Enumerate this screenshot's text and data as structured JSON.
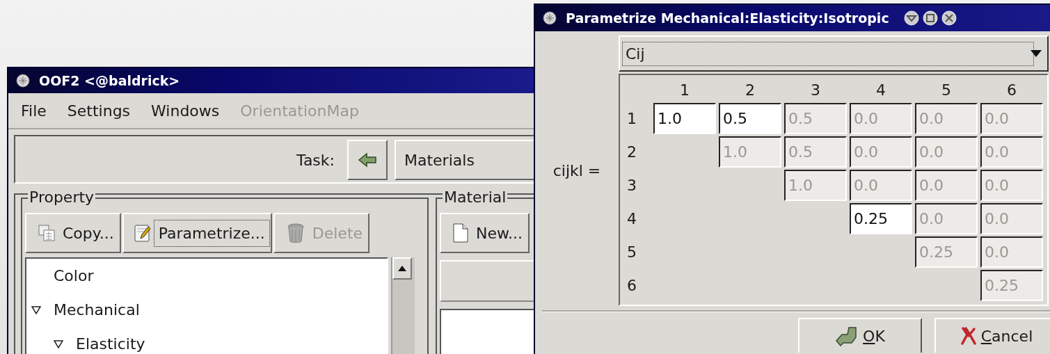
{
  "main_window": {
    "title": "OOF2 <@baldrick>",
    "menu": [
      {
        "label": "File",
        "disabled": false
      },
      {
        "label": "Settings",
        "disabled": false
      },
      {
        "label": "Windows",
        "disabled": false
      },
      {
        "label": "OrientationMap",
        "disabled": true
      }
    ],
    "task_label": "Task:",
    "task_value": "Materials",
    "property": {
      "title": "Property",
      "buttons": [
        {
          "label": "Copy...",
          "disabled": false,
          "focused": false
        },
        {
          "label": "Parametrize...",
          "disabled": false,
          "focused": true
        },
        {
          "label": "Delete",
          "disabled": true,
          "focused": false
        }
      ],
      "tree": [
        {
          "label": "Color"
        },
        {
          "label": "Mechanical",
          "expanded": true,
          "children": [
            {
              "label": "Elasticity",
              "expanded": true
            }
          ]
        }
      ]
    },
    "material": {
      "title": "Material",
      "buttons": [
        {
          "label": "New...",
          "disabled": false,
          "focused": false
        }
      ]
    }
  },
  "dialog": {
    "title": "Parametrize Mechanical:Elasticity:Isotropic",
    "choice": "Cij",
    "label": "cijkl =",
    "columns": [
      "1",
      "2",
      "3",
      "4",
      "5",
      "6"
    ],
    "rows": [
      {
        "label": "1",
        "cells": [
          {
            "value": "1.0",
            "editable": true
          },
          {
            "value": "0.5",
            "editable": true
          },
          {
            "value": "0.5",
            "editable": false
          },
          {
            "value": "0.0",
            "editable": false
          },
          {
            "value": "0.0",
            "editable": false
          },
          {
            "value": "0.0",
            "editable": false
          }
        ]
      },
      {
        "label": "2",
        "cells": [
          "",
          {
            "value": "1.0",
            "editable": false
          },
          {
            "value": "0.5",
            "editable": false
          },
          {
            "value": "0.0",
            "editable": false
          },
          {
            "value": "0.0",
            "editable": false
          },
          {
            "value": "0.0",
            "editable": false
          }
        ]
      },
      {
        "label": "3",
        "cells": [
          "",
          "",
          {
            "value": "1.0",
            "editable": false
          },
          {
            "value": "0.0",
            "editable": false
          },
          {
            "value": "0.0",
            "editable": false
          },
          {
            "value": "0.0",
            "editable": false
          }
        ]
      },
      {
        "label": "4",
        "cells": [
          "",
          "",
          "",
          {
            "value": "0.25",
            "editable": true
          },
          {
            "value": "0.0",
            "editable": false
          },
          {
            "value": "0.0",
            "editable": false
          }
        ]
      },
      {
        "label": "5",
        "cells": [
          "",
          "",
          "",
          "",
          {
            "value": "0.25",
            "editable": false
          },
          {
            "value": "0.0",
            "editable": false
          }
        ]
      },
      {
        "label": "6",
        "cells": [
          "",
          "",
          "",
          "",
          "",
          {
            "value": "0.25",
            "editable": false
          }
        ]
      }
    ],
    "buttons": [
      {
        "label": "OK",
        "kind": "ok",
        "mnemonic": true
      },
      {
        "label": "Cancel",
        "kind": "cancel",
        "mnemonic": true
      }
    ]
  }
}
